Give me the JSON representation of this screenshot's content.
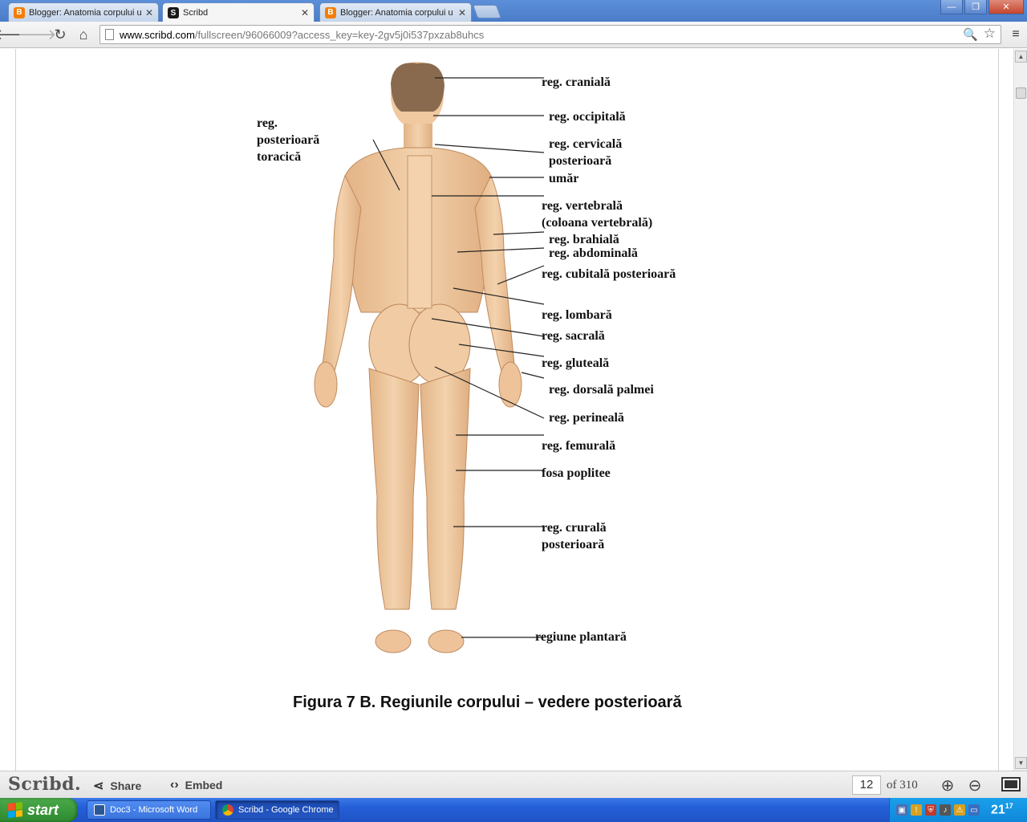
{
  "browser": {
    "tabs": [
      {
        "title": "Blogger: Anatomia corpului u",
        "icon": "blogger-icon",
        "active": false
      },
      {
        "title": "Scribd",
        "icon": "scribd-icon",
        "active": true
      },
      {
        "title": "Blogger: Anatomia corpului u",
        "icon": "blogger-icon",
        "active": false
      }
    ],
    "url_host": "www.scribd.com",
    "url_path": "/fullscreen/96066009?access_key=key-2gv5j0i537pxzab8uhcs",
    "colors": {
      "blogger": "#f57d00",
      "scribd": "#1a1a1a"
    }
  },
  "figure": {
    "labels": {
      "cranial": "reg. cranială",
      "occipital": "reg. occipitală",
      "cervical_1": "reg. cervicală",
      "cervical_2": "posterioară",
      "umar": "umăr",
      "vertebral_1": "reg. vertebrală",
      "vertebral_2": "(coloana vertebrală)",
      "brahial": "reg. brahială",
      "abdominal": "reg. abdominală",
      "cubital": "reg. cubitală posterioară",
      "lombar": "reg. lombară",
      "sacral": "reg. sacrală",
      "gluteal": "reg. gluteală",
      "dorsal_palm": "reg. dorsală palmei",
      "perineal": "reg. perineală",
      "femural": "reg. femurală",
      "poplitee": "fosa poplitee",
      "crural_1": "reg. crurală",
      "crural_2": "posterioară",
      "plantar": "regiune plantară",
      "toracic_1": "reg.",
      "toracic_2": "posterioară",
      "toracic_3": "toracică"
    },
    "caption": "Figura 7 B. Regiunile corpului – vedere posterioară",
    "skin_color": "#efc9a0"
  },
  "scribd_bar": {
    "logo": "Scribd.",
    "share_label": "Share",
    "embed_label": "Embed",
    "current_page": "12",
    "total_pages": "of 310"
  },
  "taskbar": {
    "start_label": "start",
    "tasks": [
      {
        "label": "Doc3 - Microsoft Word",
        "icon": "word-icon"
      },
      {
        "label": "Scribd - Google Chrome",
        "icon": "chrome-icon"
      }
    ],
    "clock": "21",
    "clock_sup": "17"
  }
}
